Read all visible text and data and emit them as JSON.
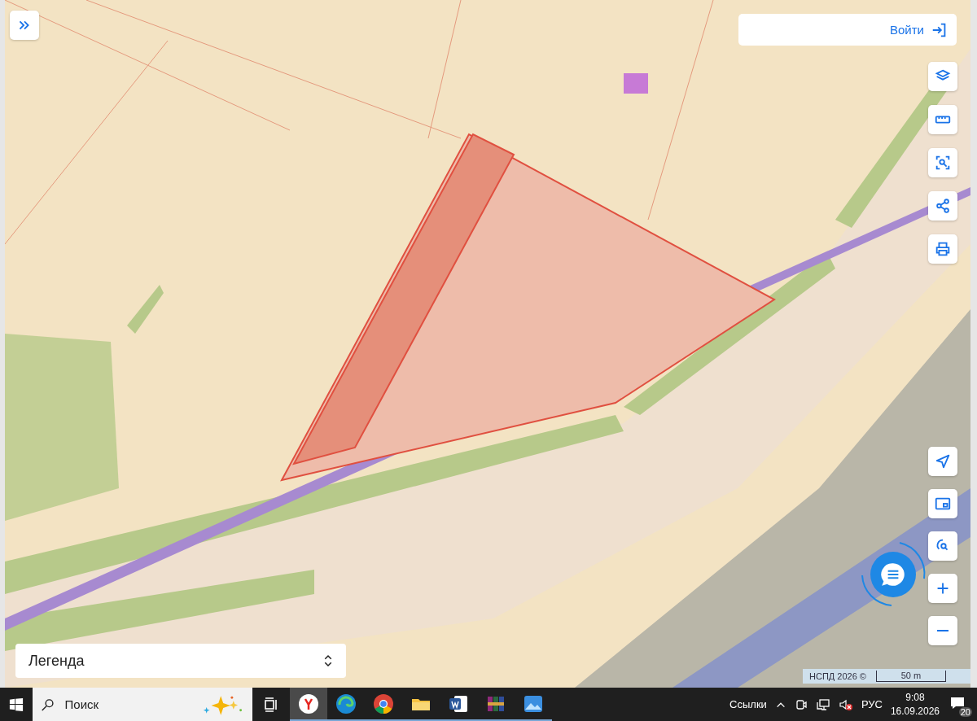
{
  "map": {
    "login": {
      "label": "Войти"
    },
    "legend": {
      "label": "Легенда"
    },
    "attribution": "НСПД 2026 ©",
    "scale": "50 m"
  },
  "taskbar": {
    "search": {
      "placeholder": "Поиск"
    },
    "apps": [
      {
        "kind": "yandex",
        "selected": true
      },
      {
        "kind": "edge",
        "selected": false
      },
      {
        "kind": "chrome",
        "selected": false
      },
      {
        "kind": "explorer",
        "selected": false
      },
      {
        "kind": "word",
        "selected": false
      },
      {
        "kind": "archiver",
        "selected": false
      },
      {
        "kind": "photos",
        "selected": false
      }
    ],
    "links": "Ссылки",
    "language": "РУС",
    "time": "9:08",
    "date": "16.09.2026",
    "notifications": "20"
  }
}
